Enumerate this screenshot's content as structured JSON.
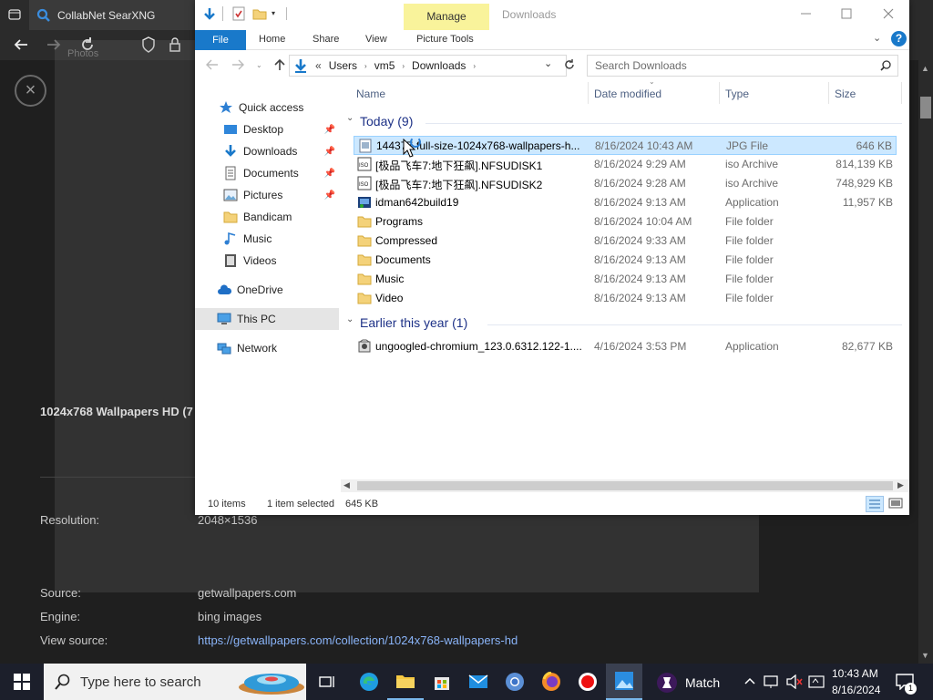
{
  "browser": {
    "tab_title": "CollabNet SearXNG",
    "photos_label": "Photos",
    "close_glyph": "×"
  },
  "page": {
    "title": "1024x768 Wallpapers HD (7",
    "resolution_label": "Resolution:",
    "resolution_value": "2048×1536",
    "source_label": "Source:",
    "source_value": "getwallpapers.com",
    "engine_label": "Engine:",
    "engine_value": "bing images",
    "view_source_label": "View source:",
    "view_source_value": "https://getwallpapers.com/collection/1024x768-wallpapers-hd"
  },
  "explorer": {
    "manage_tab": "Manage",
    "window_title": "Downloads",
    "ribbon": {
      "file": "File",
      "home": "Home",
      "share": "Share",
      "view": "View",
      "picture_tools": "Picture Tools"
    },
    "address": {
      "prefix": "«",
      "segments": [
        "Users",
        "vm5",
        "Downloads"
      ]
    },
    "search_placeholder": "Search Downloads",
    "nav": {
      "quick_access": "Quick access",
      "desktop": "Desktop",
      "downloads": "Downloads",
      "documents": "Documents",
      "pictures": "Pictures",
      "bandicam": "Bandicam",
      "music": "Music",
      "videos": "Videos",
      "onedrive": "OneDrive",
      "this_pc": "This PC",
      "network": "Network"
    },
    "columns": {
      "name": "Name",
      "date": "Date modified",
      "type": "Type",
      "size": "Size"
    },
    "groups": {
      "today": "Today (9)",
      "earlier": "Earlier this year (1)"
    },
    "files_today": [
      {
        "name": "144377-full-size-1024x768-wallpapers-h...",
        "date": "8/16/2024 10:43 AM",
        "type": "JPG File",
        "size": "646 KB",
        "icon": "image-file-icon"
      },
      {
        "name": "[极品飞车7:地下狂飙].NFSUDISK1",
        "date": "8/16/2024 9:29 AM",
        "type": "iso Archive",
        "size": "814,139 KB",
        "icon": "iso-file-icon"
      },
      {
        "name": "[极品飞车7:地下狂飙].NFSUDISK2",
        "date": "8/16/2024 9:28 AM",
        "type": "iso Archive",
        "size": "748,929 KB",
        "icon": "iso-file-icon"
      },
      {
        "name": "idman642build19",
        "date": "8/16/2024 9:13 AM",
        "type": "Application",
        "size": "11,957 KB",
        "icon": "application-icon"
      },
      {
        "name": "Programs",
        "date": "8/16/2024 10:04 AM",
        "type": "File folder",
        "size": "",
        "icon": "folder-icon"
      },
      {
        "name": "Compressed",
        "date": "8/16/2024 9:33 AM",
        "type": "File folder",
        "size": "",
        "icon": "folder-icon"
      },
      {
        "name": "Documents",
        "date": "8/16/2024 9:13 AM",
        "type": "File folder",
        "size": "",
        "icon": "folder-icon"
      },
      {
        "name": "Music",
        "date": "8/16/2024 9:13 AM",
        "type": "File folder",
        "size": "",
        "icon": "folder-icon"
      },
      {
        "name": "Video",
        "date": "8/16/2024 9:13 AM",
        "type": "File folder",
        "size": "",
        "icon": "folder-icon"
      }
    ],
    "files_earlier": [
      {
        "name": "ungoogled-chromium_123.0.6312.122-1....",
        "date": "4/16/2024 3:53 PM",
        "type": "Application",
        "size": "82,677 KB",
        "icon": "installer-icon"
      }
    ],
    "status": {
      "items": "10 items",
      "selected": "1 item selected",
      "size": "645 KB"
    }
  },
  "taskbar": {
    "search_placeholder": "Type here to search",
    "match_label": "Match",
    "time": "10:43 AM",
    "date": "8/16/2024",
    "notification_count": "1"
  },
  "colors": {
    "accent_blue": "#1979ca",
    "manage_yellow": "#f9f39b",
    "selected_row": "#cce8ff",
    "link_blue": "#8ab4f8"
  }
}
